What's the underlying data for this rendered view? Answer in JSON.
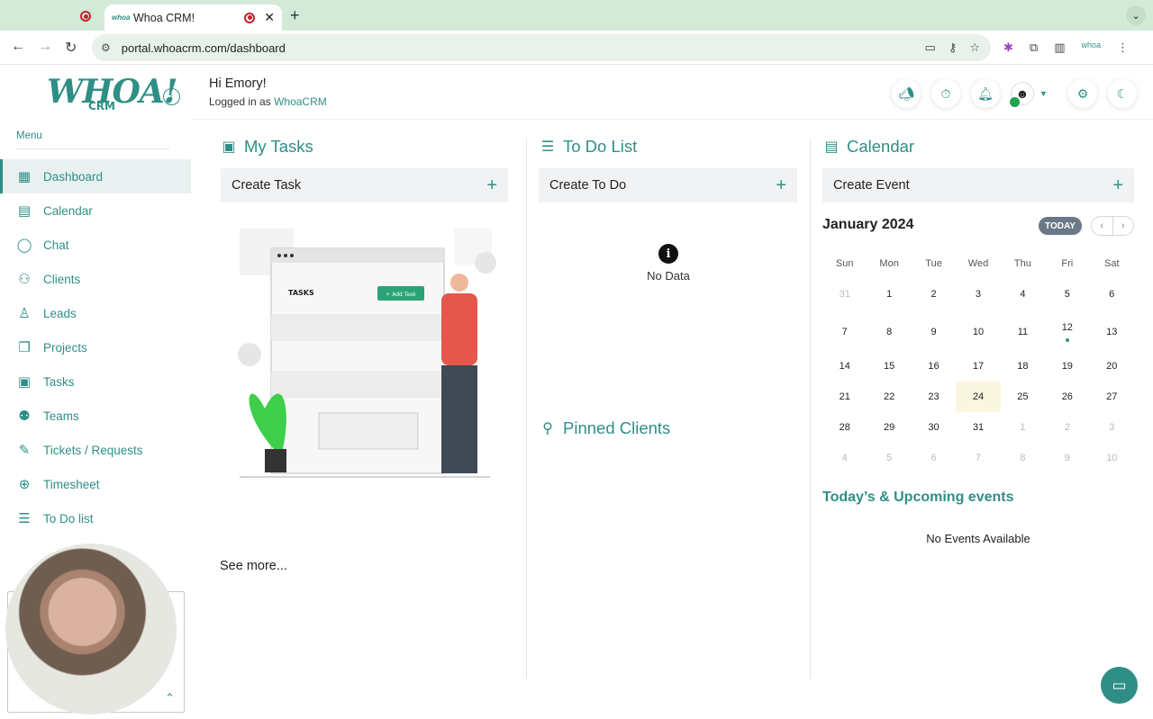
{
  "browser": {
    "active_tab_title": "Whoa CRM!",
    "url": "portal.whoacrm.com/dashboard"
  },
  "sidebar": {
    "logo_text": "WHOA!",
    "logo_sub": "CRM",
    "menu_label": "Menu",
    "items": [
      {
        "label": "Dashboard",
        "icon": "dashboard-icon",
        "active": true
      },
      {
        "label": "Calendar",
        "icon": "calendar-icon"
      },
      {
        "label": "Chat",
        "icon": "chat-icon"
      },
      {
        "label": "Clients",
        "icon": "clients-icon"
      },
      {
        "label": "Leads",
        "icon": "leads-icon"
      },
      {
        "label": "Projects",
        "icon": "projects-icon"
      },
      {
        "label": "Tasks",
        "icon": "tasks-icon"
      },
      {
        "label": "Teams",
        "icon": "teams-icon"
      },
      {
        "label": "Tickets / Requests",
        "icon": "tickets-icon"
      },
      {
        "label": "Timesheet",
        "icon": "timesheet-icon"
      },
      {
        "label": "To Do list",
        "icon": "todo-icon"
      }
    ]
  },
  "header": {
    "greeting": "Hi Emory!",
    "logged_prefix": "Logged in as",
    "logged_brand": "WhoaCRM"
  },
  "tasks": {
    "title": "My Tasks",
    "create_label": "Create Task",
    "see_more": "See more...",
    "illustration_heading": "TASKS",
    "illustration_button": "+ Add Task"
  },
  "todo": {
    "title": "To Do List",
    "create_label": "Create To Do",
    "empty_text": "No Data"
  },
  "pinned": {
    "title": "Pinned Clients"
  },
  "calendar": {
    "title": "Calendar",
    "create_label": "Create Event",
    "month": "January 2024",
    "today_label": "TODAY",
    "prev": "‹",
    "next": "›",
    "weekdays": [
      "Sun",
      "Mon",
      "Tue",
      "Wed",
      "Thu",
      "Fri",
      "Sat"
    ],
    "weeks": [
      [
        "31",
        "1",
        "2",
        "3",
        "4",
        "5",
        "6"
      ],
      [
        "7",
        "8",
        "9",
        "10",
        "11",
        "12",
        "13"
      ],
      [
        "14",
        "15",
        "16",
        "17",
        "18",
        "19",
        "20"
      ],
      [
        "21",
        "22",
        "23",
        "24",
        "25",
        "26",
        "27"
      ],
      [
        "28",
        "29",
        "30",
        "31",
        "1",
        "2",
        "3"
      ],
      [
        "4",
        "5",
        "6",
        "7",
        "8",
        "9",
        "10"
      ]
    ],
    "today_date": "24",
    "event_dates": [
      "12"
    ]
  },
  "upcoming": {
    "title": "Today’s & Upcoming events",
    "empty_text": "No Events Available"
  },
  "colors": {
    "brand": "#2f8f87",
    "today_bg": "#fbf6e0"
  }
}
